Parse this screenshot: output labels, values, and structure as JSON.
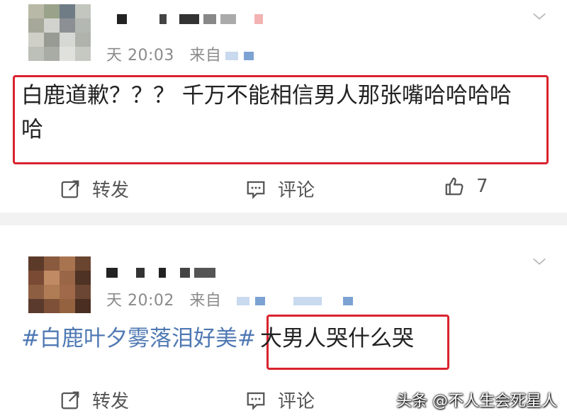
{
  "posts": [
    {
      "time_text": "天 20:03",
      "source_text": "来自",
      "content": "白鹿道歉？？？ 千万不能相信男人那张嘴哈哈哈哈哈",
      "content_line1": "白鹿道歉？？？ 千万不能相信男人那张嘴哈哈哈哈",
      "content_line2": "哈",
      "actions": {
        "repost": "转发",
        "comment": "评论",
        "like_count": "7"
      },
      "icons": [
        "repost-icon",
        "comment-icon",
        "like-icon",
        "chevron-down-icon"
      ]
    },
    {
      "time_text": "天 20:02",
      "source_text": "来自",
      "hashtag": "#白鹿叶夕雾落泪好美#",
      "content": "大男人哭什么哭",
      "actions": {
        "repost": "转发",
        "comment": "评论"
      },
      "icons": [
        "repost-icon",
        "comment-icon",
        "chevron-down-icon"
      ]
    }
  ],
  "watermark": "头条 @不人生会死星人",
  "colors": {
    "highlight_box": "#d9232e",
    "hashtag": "#4f79b3",
    "divider": "#f2f2f2"
  }
}
